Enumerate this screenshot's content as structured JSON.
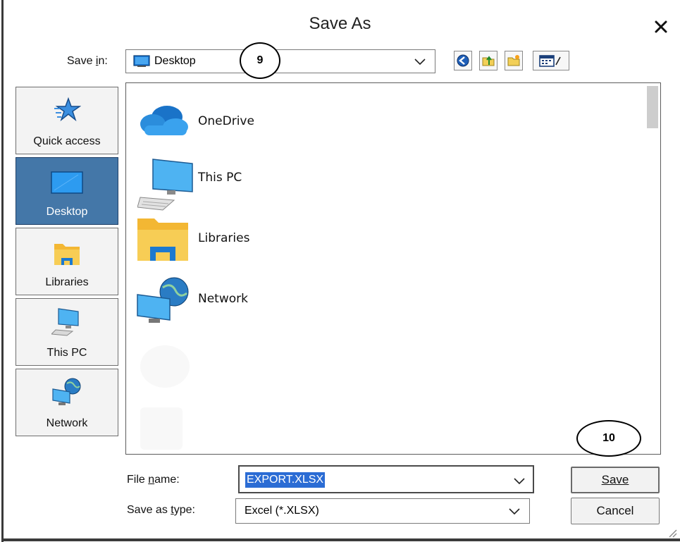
{
  "dialog": {
    "title": "Save As",
    "close_icon": "close-icon"
  },
  "save_in": {
    "label": "Save in:",
    "value": "Desktop",
    "icon": "desktop-icon"
  },
  "toolbar": {
    "buttons": [
      "back-icon",
      "up-folder-icon",
      "new-folder-icon",
      "view-menu-icon"
    ]
  },
  "places": [
    {
      "label": "Quick access",
      "icon": "star-icon",
      "active": false
    },
    {
      "label": "Desktop",
      "icon": "desktop-icon",
      "active": true
    },
    {
      "label": "Libraries",
      "icon": "libraries-icon",
      "active": false
    },
    {
      "label": "This PC",
      "icon": "computer-icon",
      "active": false
    },
    {
      "label": "Network",
      "icon": "network-icon",
      "active": false
    }
  ],
  "file_list": {
    "items": [
      {
        "label": "OneDrive",
        "icon": "onedrive-cloud-icon"
      },
      {
        "label": "This PC",
        "icon": "computer-icon"
      },
      {
        "label": "Libraries",
        "icon": "libraries-icon"
      },
      {
        "label": "Network",
        "icon": "network-icon"
      }
    ]
  },
  "callouts": {
    "step_9": "9",
    "step_10": "10"
  },
  "file_name": {
    "label": "File name:",
    "value": "EXPORT.XLSX"
  },
  "save_as_type": {
    "label": "Save as type:",
    "value": "Excel (*.XLSX)"
  },
  "buttons": {
    "save": "Save",
    "cancel": "Cancel"
  },
  "colors": {
    "active_place_bg": "#4477a8",
    "selection_bg": "#2b6cd4"
  }
}
